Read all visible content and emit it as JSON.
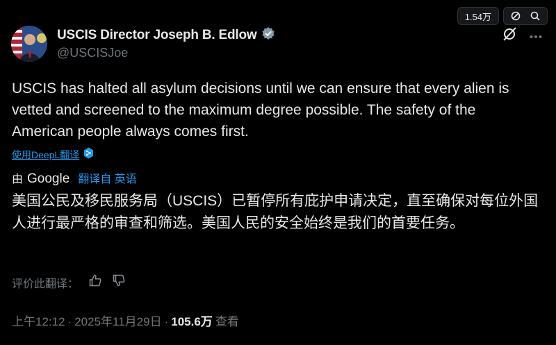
{
  "topbar": {
    "count_pill": "1.54万"
  },
  "author": {
    "name": "USCIS Director Joseph B. Edlow",
    "handle": "@USCISJoe",
    "verified_color": "#829aab"
  },
  "tweet": {
    "text": "USCIS has halted all asylum decisions until we can ensure that every alien is vetted and screened to the maximum degree possible. The safety of the American people always comes first."
  },
  "deepl": {
    "label": "使用DeepL翻译"
  },
  "translation": {
    "by": "由",
    "provider": "Google",
    "from": "翻译自 英语",
    "text": "美国公民及移民服务局（USCIS）已暂停所有庇护申请决定，直至确保对每位外国人进行最严格的审查和筛选。美国人民的安全始终是我们的首要任务。"
  },
  "rate": {
    "label": "评价此翻译："
  },
  "meta": {
    "time": "上午12:12",
    "sep1": "·",
    "date": "2025年11月29日",
    "sep2": "·",
    "views": "105.6万",
    "views_label": "查看"
  },
  "icons": [
    "block-icon",
    "search-icon",
    "grok-icon",
    "more-icon",
    "verified-badge-icon",
    "deepl-icon",
    "thumbs-up-icon",
    "thumbs-down-icon"
  ]
}
